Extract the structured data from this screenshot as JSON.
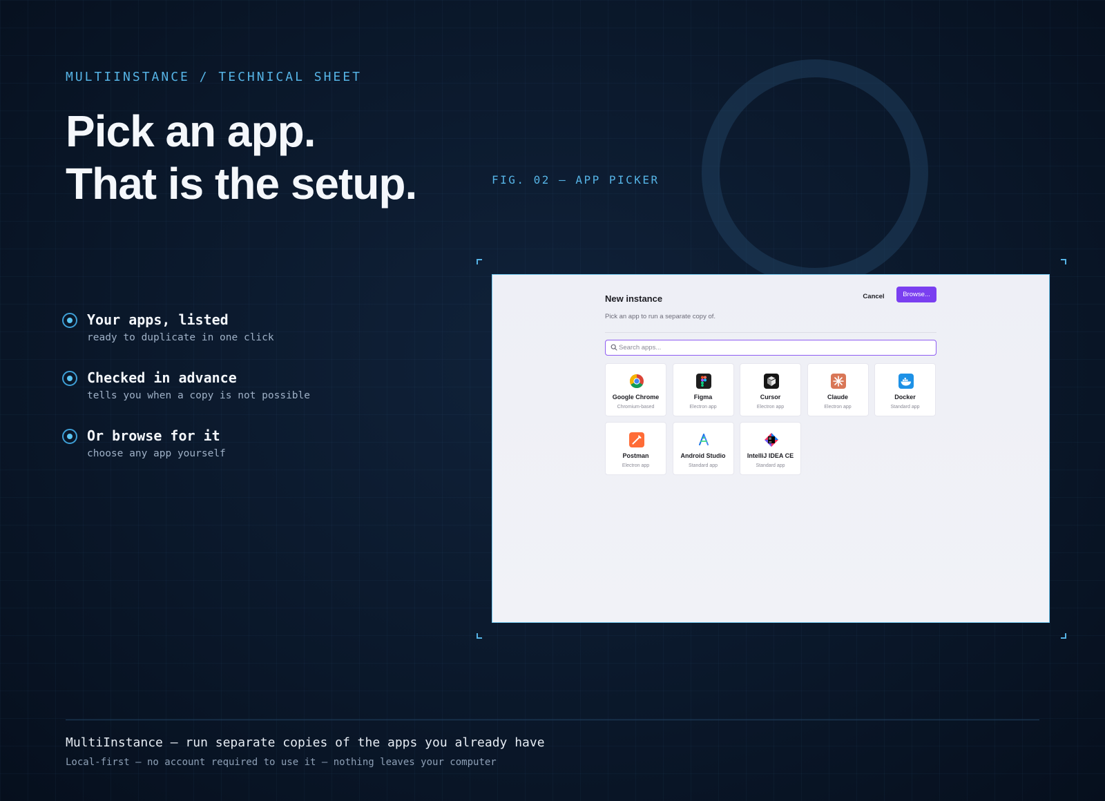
{
  "header": {
    "eyebrow": "MULTIINSTANCE / TECHNICAL SHEET",
    "headline_line1": "Pick an app.",
    "headline_line2": "That is the setup.",
    "figure_label": "FIG. 02 — APP PICKER"
  },
  "features": [
    {
      "title": "Your apps, listed",
      "subtitle": "ready to duplicate in one click"
    },
    {
      "title": "Checked in advance",
      "subtitle": "tells you when a copy is not possible"
    },
    {
      "title": "Or browse for it",
      "subtitle": "choose any app yourself"
    }
  ],
  "dialog": {
    "title": "New instance",
    "subtitle": "Pick an app to run a separate copy of.",
    "cancel_label": "Cancel",
    "browse_label": "Browse...",
    "search_placeholder": "Search apps...",
    "search_value": "",
    "apps": [
      {
        "name": "Google Chrome",
        "kind": "Chromium-based",
        "icon": "chrome-icon"
      },
      {
        "name": "Figma",
        "kind": "Electron app",
        "icon": "figma-icon"
      },
      {
        "name": "Cursor",
        "kind": "Electron app",
        "icon": "cursor-icon"
      },
      {
        "name": "Claude",
        "kind": "Electron app",
        "icon": "claude-icon"
      },
      {
        "name": "Docker",
        "kind": "Standard app",
        "icon": "docker-icon"
      },
      {
        "name": "Postman",
        "kind": "Electron app",
        "icon": "postman-icon"
      },
      {
        "name": "Android Studio",
        "kind": "Standard app",
        "icon": "android-studio-icon"
      },
      {
        "name": "IntelliJ IDEA CE",
        "kind": "Standard app",
        "icon": "intellij-icon"
      }
    ]
  },
  "footer": {
    "title": "MultiInstance — run separate copies of the apps you already have",
    "subtitle": "Local-first — no account required to use it — nothing leaves your computer"
  },
  "colors": {
    "background": "#0b1a2e",
    "accent": "#56b4e6",
    "primary_button": "#7a3ff0",
    "search_focus": "#8e5cf2"
  }
}
